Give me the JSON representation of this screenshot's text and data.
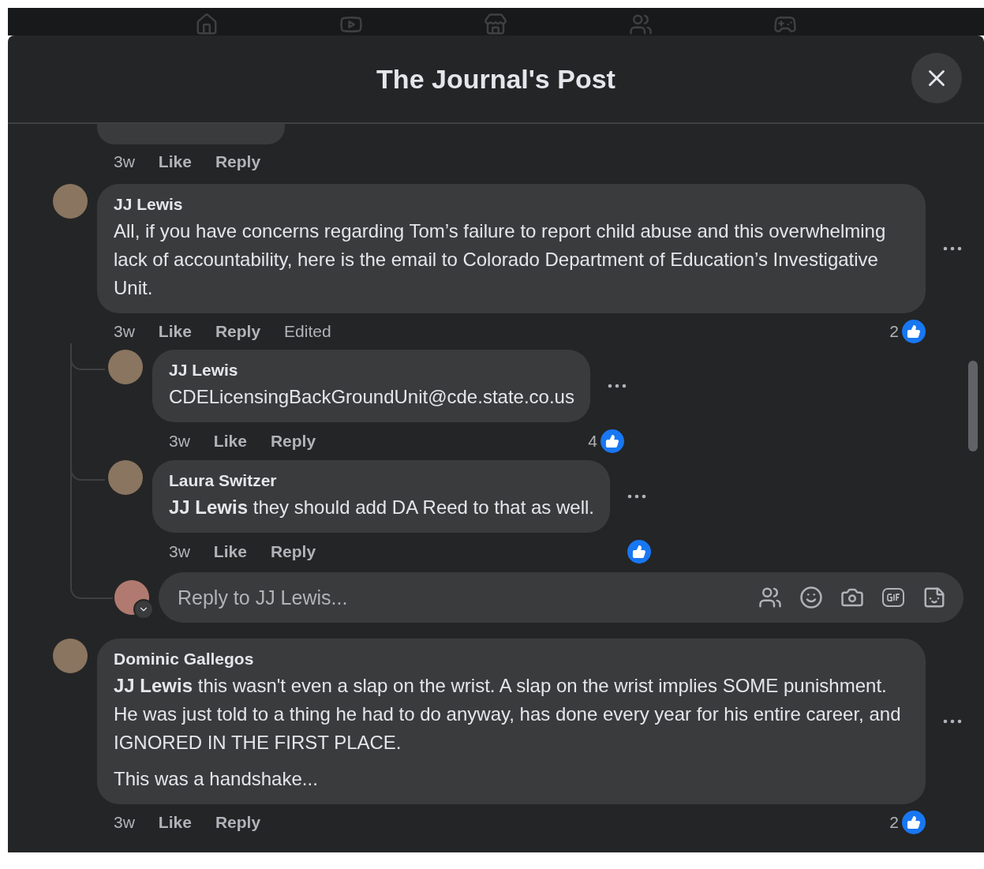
{
  "dialog": {
    "title": "The Journal's Post"
  },
  "previous_comment": {
    "time": "3w",
    "actions": [
      "Like",
      "Reply"
    ]
  },
  "comment": {
    "author": "JJ Lewis",
    "paragraphs": [
      "All, if you have concerns regarding Tom’s failure to report child abuse and this overwhelming lack of accountability, here is the email to Colorado Department of Education’s Investigative Unit."
    ],
    "time": "3w",
    "actions": [
      "Like",
      "Reply",
      "Edited"
    ],
    "reaction_count": "2",
    "replies": [
      {
        "author": "JJ Lewis",
        "paragraphs": [
          "CDELicensingBackGroundUnit@cde.state.co.us"
        ],
        "time": "3w",
        "actions": [
          "Like",
          "Reply"
        ],
        "reaction_count": "4"
      },
      {
        "author": "Laura Switzer",
        "paragraphs": [
          "**JJ Lewis** they should add DA Reed to that as well."
        ],
        "time": "3w",
        "actions": [
          "Like",
          "Reply"
        ]
      }
    ],
    "reply_box": {
      "placeholder": "Reply to JJ Lewis..."
    }
  },
  "next_comment": {
    "author": "Dominic Gallegos",
    "paragraphs": [
      "**JJ Lewis** this wasn't even a slap on the wrist. A slap on the wrist implies SOME punishment. He was just told to a thing he had to do anyway, has done every year for his entire career, and IGNORED IN THE FIRST PLACE.",
      "This was a handshake..."
    ],
    "time": "3w",
    "actions": [
      "Like",
      "Reply"
    ],
    "reaction_count": "2"
  }
}
